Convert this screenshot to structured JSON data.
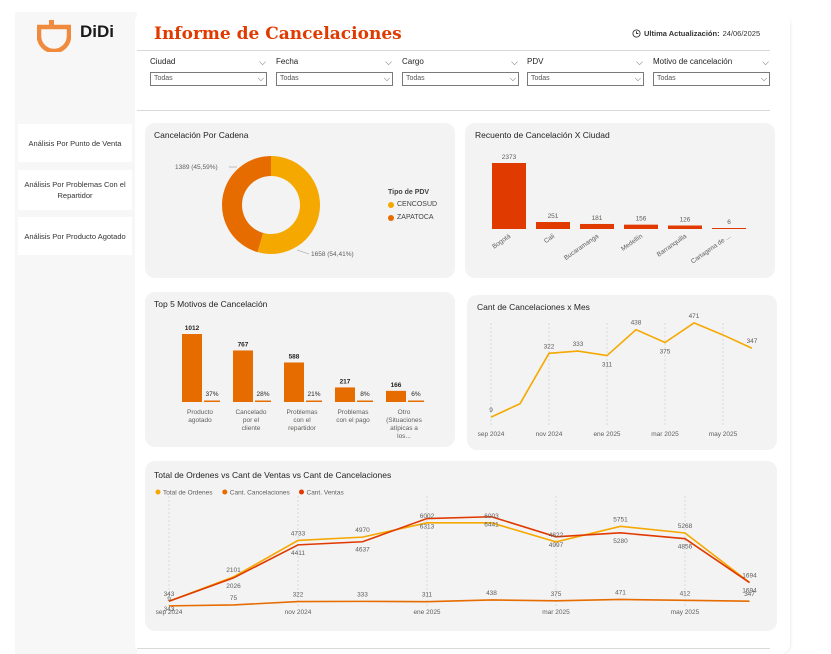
{
  "brand": {
    "name": "DiDi"
  },
  "header": {
    "title": "Informe de Cancelaciones",
    "update_label": "Ultima Actualización:",
    "update_value": "24/06/2025"
  },
  "sidebar": {
    "items": [
      {
        "label": "Análisis Por Punto de Venta"
      },
      {
        "label": "Análisis Por Problemas Con el Repartidor"
      },
      {
        "label": "Análisis Por Producto Agotado"
      }
    ]
  },
  "filters": [
    {
      "label": "Ciudad",
      "value": "Todas"
    },
    {
      "label": "Fecha",
      "value": "Todas"
    },
    {
      "label": "Cargo",
      "value": "Todas"
    },
    {
      "label": "PDV",
      "value": "Todas"
    },
    {
      "label": "Motivo de cancelación",
      "value": "Todas"
    }
  ],
  "colors": {
    "accent": "#e03a00",
    "orange": "#e66c00",
    "yellow": "#f5a800",
    "red": "#e03a00"
  },
  "charts": {
    "cadena": {
      "title": "Cancelación Por Cadena",
      "legend_title": "Tipo de PDV",
      "chart_data": {
        "type": "pie",
        "slices": [
          {
            "name": "CENCOSUD",
            "value": 1658,
            "label": "1658 (54,41%)",
            "color": "#f5a800"
          },
          {
            "name": "ZAPATOCA",
            "value": 1389,
            "label": "1389 (45,59%)",
            "color": "#e66c00"
          }
        ]
      }
    },
    "ciudad": {
      "title": "Recuento de Cancelación X Ciudad",
      "chart_data": {
        "type": "bar",
        "categories": [
          "Bogotá",
          "Cali",
          "Bucaramanga",
          "Medellín",
          "Barranquilla",
          "Cartagena de ..."
        ],
        "values": [
          2373,
          251,
          181,
          156,
          126,
          6
        ]
      }
    },
    "motivos": {
      "title": "Top 5 Motivos de Cancelación",
      "chart_data": {
        "type": "bar",
        "categories": [
          "Producto agotado",
          "Cancelado por el cliente",
          "Problemas con el repartidor",
          "Problemas con el pago",
          "Otro (Situaciones atípicas a los..."
        ],
        "values": [
          1012,
          767,
          588,
          217,
          166
        ],
        "percent_labels": [
          "37%",
          "28%",
          "21%",
          "8%",
          "6%"
        ],
        "percents": [
          37,
          28,
          21,
          8,
          6
        ]
      }
    },
    "mes": {
      "title": "Cant de Cancelaciones x Mes",
      "chart_data": {
        "type": "line",
        "x": [
          "sep 2024",
          "oct 2024",
          "nov 2024",
          "dic 2024",
          "ene 2025",
          "feb 2025",
          "mar 2025",
          "abr 2025",
          "may 2025",
          "jun 2025"
        ],
        "values": [
          9,
          75,
          322,
          333,
          311,
          438,
          375,
          471,
          412,
          347
        ],
        "point_labels": [
          "9",
          "",
          "322",
          "333",
          "311",
          "438",
          "375",
          "471",
          "",
          "347"
        ],
        "tick_labels": [
          "sep 2024",
          "nov 2024",
          "ene 2025",
          "mar 2025",
          "may 2025"
        ]
      }
    },
    "total": {
      "title": "Total de Ordenes vs Cant de Ventas vs Cant de Cancelaciones",
      "chart_data": {
        "type": "line",
        "x": [
          "sep 2024",
          "oct 2024",
          "nov 2024",
          "dic 2024",
          "ene 2025",
          "feb 2025",
          "mar 2025",
          "abr 2025",
          "may 2025",
          "jun 2025"
        ],
        "tick_labels": [
          "sep 2024",
          "nov 2024",
          "ene 2025",
          "mar 2025",
          "may 2025"
        ],
        "series": [
          {
            "name": "Total de Ordenes",
            "color": "#f5a800",
            "values": [
              343,
              2101,
              4733,
              4970,
              6002,
              6003,
              4622,
              5751,
              5268,
              1694
            ]
          },
          {
            "name": "Cant. Cancelaciones",
            "color": "#e66c00",
            "values": [
              9,
              75,
              322,
              333,
              311,
              438,
              375,
              471,
              412,
              347
            ]
          },
          {
            "name": "Cant. Ventas",
            "color": "#e03a00",
            "values": [
              343,
              2026,
              4411,
              4637,
              6313,
              6441,
              4997,
              5280,
              4856,
              1694
            ]
          }
        ]
      }
    }
  }
}
